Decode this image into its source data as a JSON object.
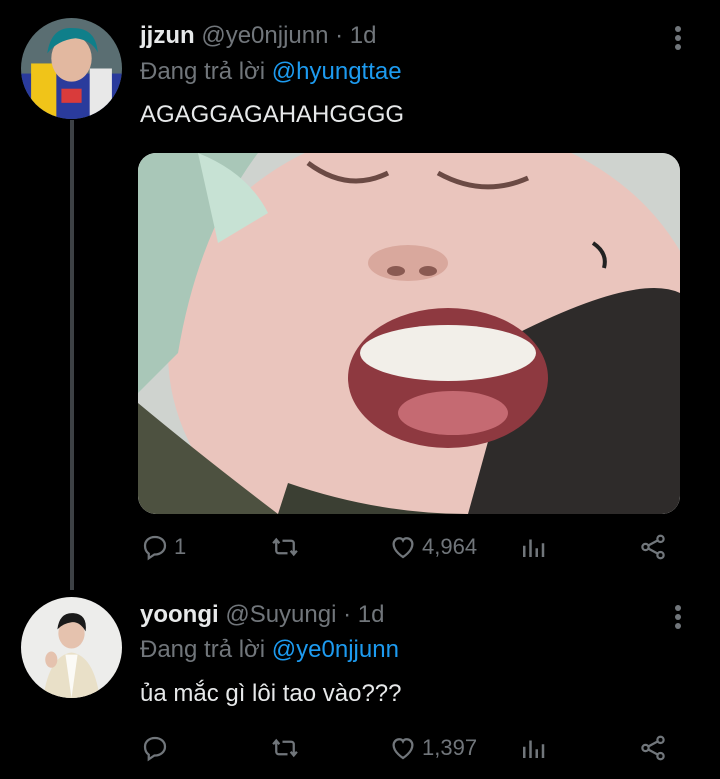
{
  "tweets": [
    {
      "name": "jjzun",
      "handle": "@ye0njjunn",
      "separator": "·",
      "time": "1d",
      "reply_prefix": "Đang trả lời",
      "reply_to": "@hyungttae",
      "text": "AGAGGAGAHAHGGGG",
      "has_media": true,
      "replies": "1",
      "retweets": "",
      "likes": "4,964"
    },
    {
      "name": "yoongi",
      "handle": "@Suyungi",
      "separator": "·",
      "time": "1d",
      "reply_prefix": "Đang trả lời",
      "reply_to": "@ye0njjunn",
      "text": "ủa mắc gì lôi tao vào???",
      "has_media": false,
      "replies": "",
      "retweets": "",
      "likes": "1,397"
    }
  ],
  "colors": {
    "background": "#000000",
    "text": "#e7e9ea",
    "muted": "#71767b",
    "accent": "#1d9bf0"
  },
  "icons": [
    "reply-icon",
    "retweet-icon",
    "like-icon",
    "analytics-icon",
    "share-icon",
    "more-icon"
  ]
}
